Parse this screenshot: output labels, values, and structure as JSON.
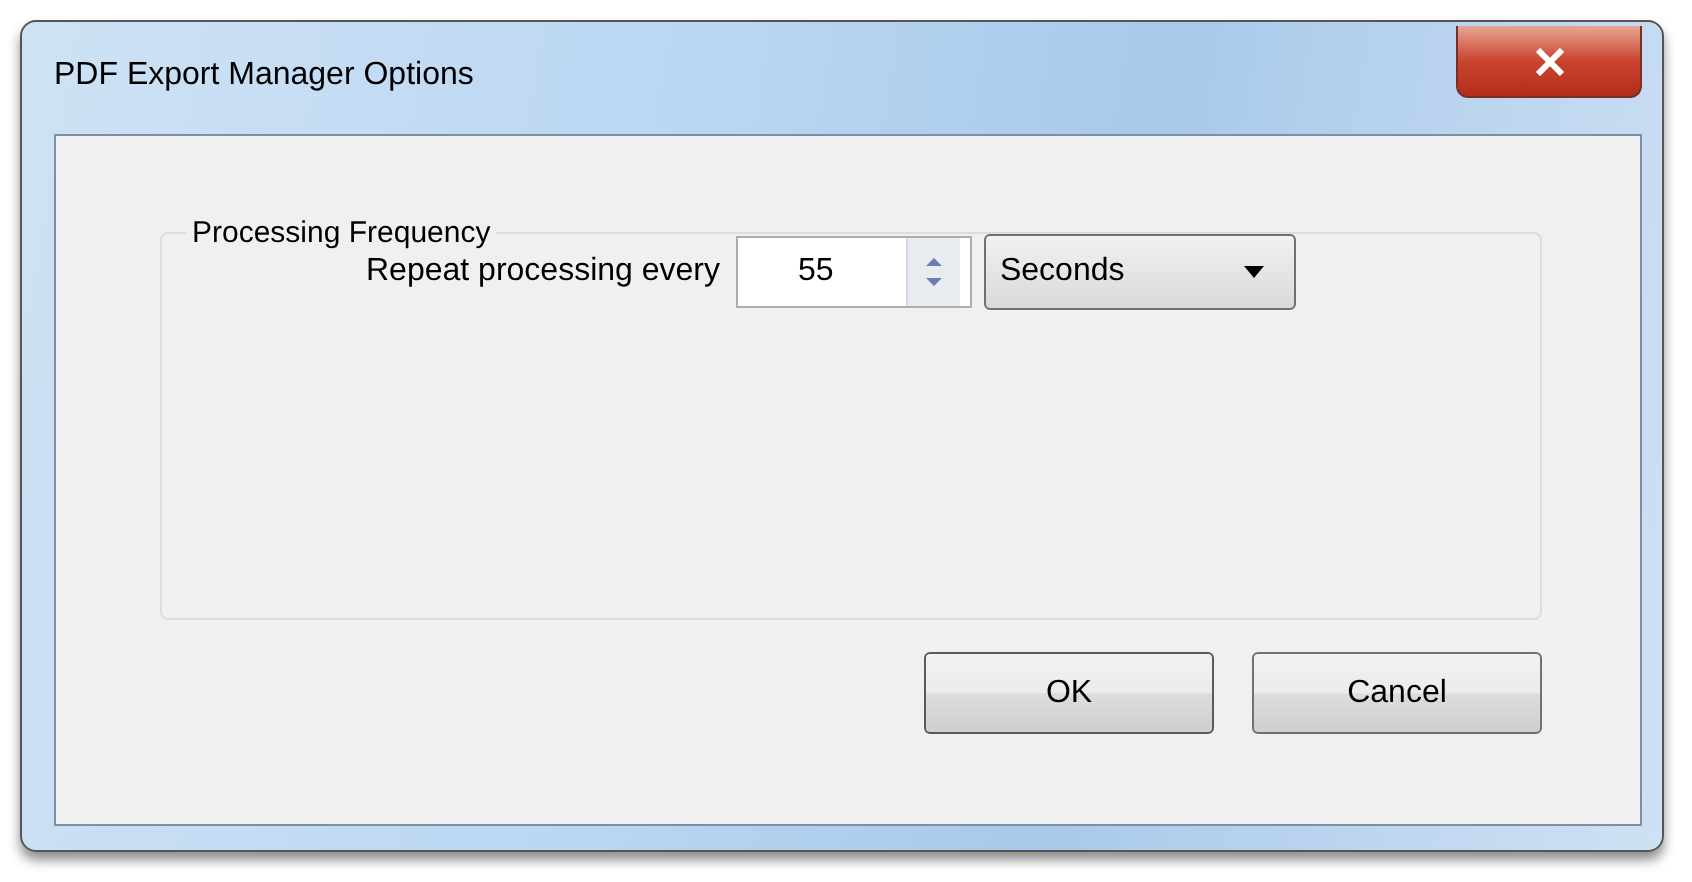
{
  "window": {
    "title": "PDF Export Manager Options"
  },
  "group": {
    "title": "Processing Frequency",
    "label": "Repeat processing every",
    "spinner": {
      "value": "55"
    },
    "unit": {
      "value": "Seconds"
    }
  },
  "buttons": [
    {
      "label": "OK",
      "kind": "default"
    },
    {
      "label": "Cancel",
      "kind": "normal"
    }
  ]
}
